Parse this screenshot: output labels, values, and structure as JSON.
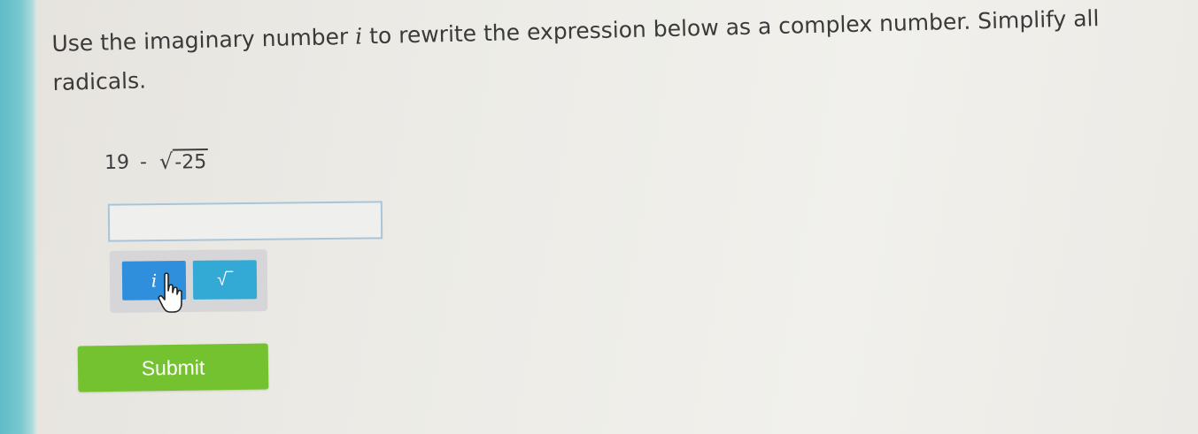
{
  "question": {
    "text_before": "Use the imaginary number ",
    "variable": "i",
    "text_after": " to rewrite the expression below as a complex number. Simplify all radicals."
  },
  "expression": {
    "number": "19",
    "operator": "-",
    "radicand": "-25"
  },
  "answer": {
    "value": ""
  },
  "palette": {
    "i_label": "i",
    "sqrt_label": "√‾"
  },
  "submit_label": "Submit"
}
